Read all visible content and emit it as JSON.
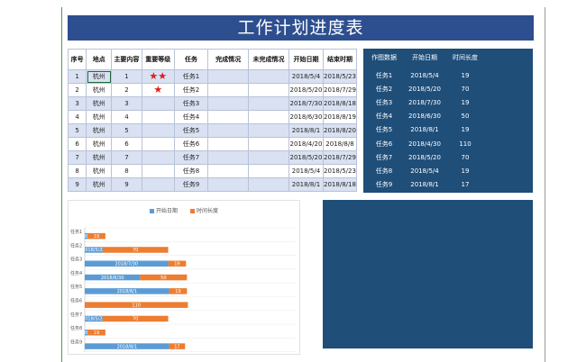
{
  "title": "工作计划进度表",
  "table": {
    "headers": [
      "序号",
      "地点",
      "主要内容",
      "重要等级",
      "任务",
      "完成情况",
      "未完成情况",
      "开始日期",
      "结束时期"
    ],
    "rows": [
      {
        "no": "1",
        "place": "杭州",
        "content": "1",
        "stars": "★★",
        "task": "任务1",
        "done": "",
        "undone": "",
        "start": "2018/5/4",
        "end": "2018/5/23"
      },
      {
        "no": "2",
        "place": "杭州",
        "content": "2",
        "stars": "★",
        "task": "任务2",
        "done": "",
        "undone": "",
        "start": "2018/5/20",
        "end": "2018/7/29"
      },
      {
        "no": "3",
        "place": "杭州",
        "content": "3",
        "stars": "",
        "task": "任务3",
        "done": "",
        "undone": "",
        "start": "2018/7/30",
        "end": "2018/8/18"
      },
      {
        "no": "4",
        "place": "杭州",
        "content": "4",
        "stars": "",
        "task": "任务4",
        "done": "",
        "undone": "",
        "start": "2018/6/30",
        "end": "2018/8/19"
      },
      {
        "no": "5",
        "place": "杭州",
        "content": "5",
        "stars": "",
        "task": "任务5",
        "done": "",
        "undone": "",
        "start": "2018/8/1",
        "end": "2018/8/20"
      },
      {
        "no": "6",
        "place": "杭州",
        "content": "6",
        "stars": "",
        "task": "任务6",
        "done": "",
        "undone": "",
        "start": "2018/4/20",
        "end": "2018/8/8"
      },
      {
        "no": "7",
        "place": "杭州",
        "content": "7",
        "stars": "",
        "task": "任务7",
        "done": "",
        "undone": "",
        "start": "2018/5/20",
        "end": "2018/7/29"
      },
      {
        "no": "8",
        "place": "杭州",
        "content": "8",
        "stars": "",
        "task": "任务8",
        "done": "",
        "undone": "",
        "start": "2018/5/4",
        "end": "2018/5/23"
      },
      {
        "no": "9",
        "place": "杭州",
        "content": "9",
        "stars": "",
        "task": "任务9",
        "done": "",
        "undone": "",
        "start": "2018/8/1",
        "end": "2018/8/18"
      }
    ]
  },
  "side": {
    "headers": [
      "作图数据",
      "开始日期",
      "时间长度"
    ],
    "rows": [
      [
        "任务1",
        "2018/5/4",
        "19"
      ],
      [
        "任务2",
        "2018/5/20",
        "70"
      ],
      [
        "任务3",
        "2018/7/30",
        "19"
      ],
      [
        "任务4",
        "2018/6/30",
        "50"
      ],
      [
        "任务5",
        "2018/8/1",
        "19"
      ],
      [
        "任务6",
        "2018/4/30",
        "110"
      ],
      [
        "任务7",
        "2018/5/20",
        "70"
      ],
      [
        "任务8",
        "2018/5/4",
        "19"
      ],
      [
        "任务9",
        "2018/8/1",
        "17"
      ]
    ]
  },
  "chart_data": {
    "type": "bar",
    "orientation": "horizontal-stacked",
    "legend": [
      "开始日期",
      "时间长度"
    ],
    "legend_position": "top",
    "categories": [
      "任务1",
      "任务2",
      "任务3",
      "任务4",
      "任务5",
      "任务6",
      "任务7",
      "任务8",
      "任务9"
    ],
    "series": [
      {
        "name": "开始日期",
        "values": [
          "2018/5/4",
          "2018/5/20",
          "2018/7/30",
          "2018/6/30",
          "2018/8/1",
          "",
          "2018/5/20",
          "2018/5/4",
          "2018/8/1"
        ]
      },
      {
        "name": "时间长度",
        "values": [
          19,
          70,
          19,
          50,
          19,
          110,
          70,
          19,
          17
        ]
      }
    ],
    "colors": {
      "start": "#5b9bd5",
      "length": "#ed7d31"
    },
    "start_day_offsets": [
      3,
      19,
      89,
      59,
      90,
      0,
      19,
      3,
      90
    ],
    "x_range_days": [
      0,
      225
    ]
  }
}
